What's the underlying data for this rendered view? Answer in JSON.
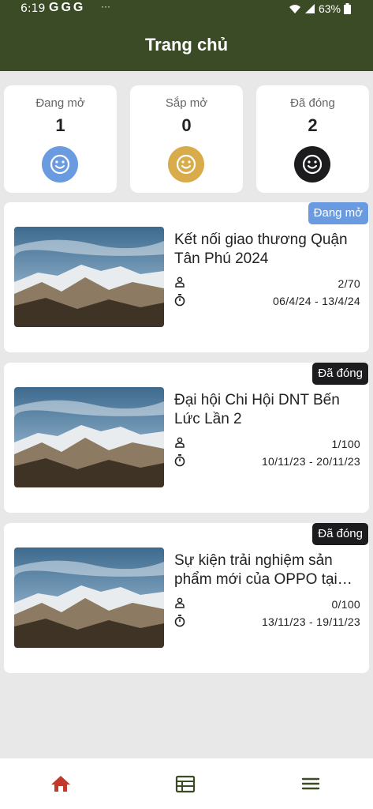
{
  "status_bar": {
    "time": "6:19",
    "g_icons": "GGG",
    "dots": "···",
    "battery": "63%"
  },
  "header": {
    "title": "Trang chủ"
  },
  "stats": [
    {
      "label": "Đang mở",
      "count": "1",
      "color": "#6a9be0"
    },
    {
      "label": "Sắp mở",
      "count": "0",
      "color": "#d8ac4a"
    },
    {
      "label": "Đã đóng",
      "count": "2",
      "color": "#1c1c1e"
    }
  ],
  "events": [
    {
      "status": "Đang mở",
      "status_color": "#6a9be0",
      "title": "Kết nối giao thương Quận Tân Phú 2024",
      "participants": "2/70",
      "dates": "06/4/24 - 13/4/24"
    },
    {
      "status": "Đã đóng",
      "status_color": "#1c1c1e",
      "title": "Đại hội Chi Hội DNT Bến Lức Lần 2",
      "participants": "1/100",
      "dates": "10/11/23 - 20/11/23"
    },
    {
      "status": "Đã đóng",
      "status_color": "#1c1c1e",
      "title": "Sự kiện trải nghiệm sản phẩm mới của OPPO tại Tân Phú",
      "participants": "0/100",
      "dates": "13/11/23 - 19/11/23"
    }
  ],
  "bottom_nav": [
    {
      "icon": "home-icon",
      "color": "#c0392b"
    },
    {
      "icon": "calendar-icon",
      "color": "#3b4b26"
    },
    {
      "icon": "menu-icon",
      "color": "#3b4b26"
    }
  ]
}
